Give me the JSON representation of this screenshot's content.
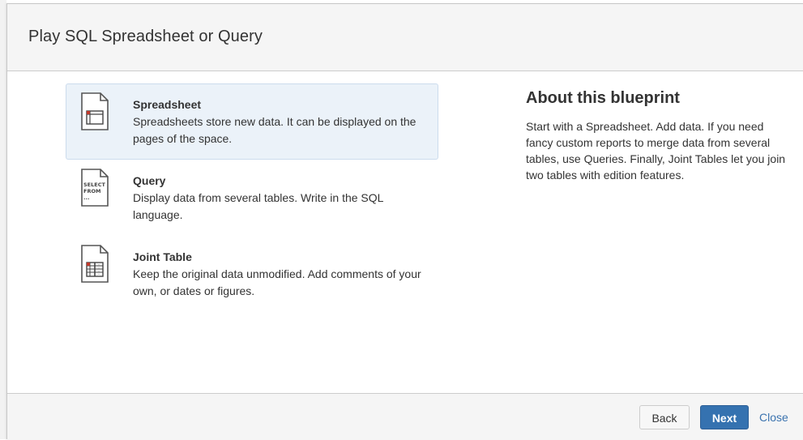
{
  "dialog": {
    "title": "Play SQL Spreadsheet or Query"
  },
  "blueprints": [
    {
      "name": "Spreadsheet",
      "description": "Spreadsheets store new data. It can be displayed on the pages of the space.",
      "icon": "spreadsheet-file-icon",
      "selected": true
    },
    {
      "name": "Query",
      "description": "Display data from several tables. Write in the SQL language.",
      "icon": "query-file-icon",
      "icon_text": [
        "SELECT",
        "FROM",
        "..."
      ],
      "selected": false
    },
    {
      "name": "Joint Table",
      "description": "Keep the original data unmodified. Add comments of your own, or dates or figures.",
      "icon": "joint-table-file-icon",
      "selected": false
    }
  ],
  "about": {
    "heading": "About this blueprint",
    "text": "Start with a Spreadsheet. Add data. If you need fancy custom reports to merge data from several tables, use Queries. Finally, Joint Tables let you join two tables with edition features."
  },
  "footer": {
    "back_label": "Back",
    "next_label": "Next",
    "close_label": "Close"
  },
  "colors": {
    "selected_bg": "#ebf2f9",
    "primary_button": "#3572b0",
    "link": "#3b73af",
    "icon_accent": "#c0392b"
  }
}
